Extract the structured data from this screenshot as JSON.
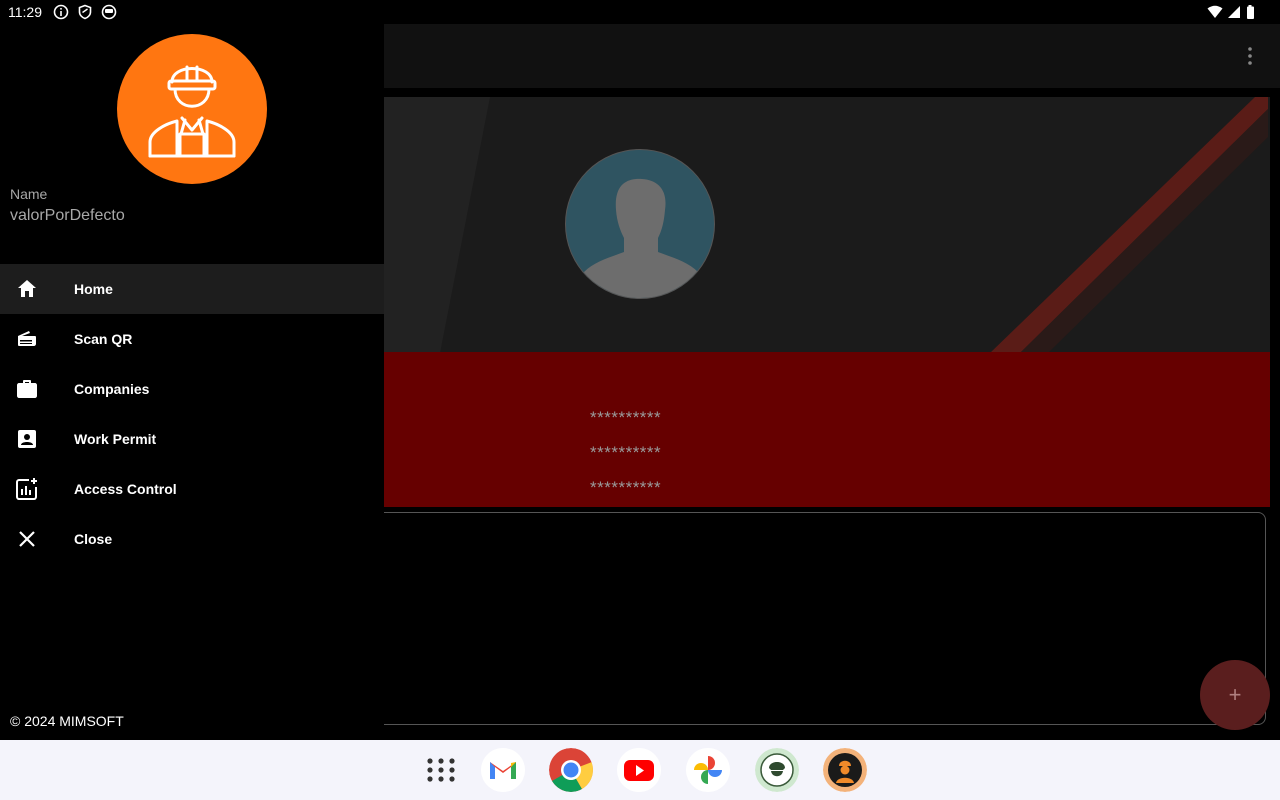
{
  "status_bar": {
    "time": "11:29",
    "left_icons": [
      "info-icon",
      "shield-icon",
      "vpn-icon"
    ],
    "right_icons": [
      "wifi-icon",
      "signal-icon",
      "battery-icon"
    ]
  },
  "app_bar": {
    "menu_icon": "more-vert-icon"
  },
  "profile": {
    "masked_fields": [
      "**********",
      "**********",
      "**********"
    ]
  },
  "fab": {
    "label": "+"
  },
  "drawer": {
    "name_label": "Name",
    "name_value": "valorPorDefecto",
    "menu": [
      {
        "label": "Home",
        "icon": "home-icon",
        "active": true
      },
      {
        "label": "Scan QR",
        "icon": "scan-qr-icon",
        "active": false
      },
      {
        "label": "Companies",
        "icon": "briefcase-icon",
        "active": false
      },
      {
        "label": "Work Permit",
        "icon": "badge-icon",
        "active": false
      },
      {
        "label": "Access Control",
        "icon": "access-control-icon",
        "active": false
      },
      {
        "label": "Close",
        "icon": "close-icon",
        "active": false
      }
    ],
    "copyright": "© 2024 MIMSOFT"
  },
  "taskbar": {
    "apps": [
      "app-drawer-icon",
      "gmail-icon",
      "chrome-icon",
      "youtube-icon",
      "photos-icon",
      "security-app-icon",
      "worker-app-icon"
    ]
  },
  "colors": {
    "accent_orange": "#ff7611",
    "panel_red": "#660000",
    "avatar_teal": "#2f5461"
  }
}
